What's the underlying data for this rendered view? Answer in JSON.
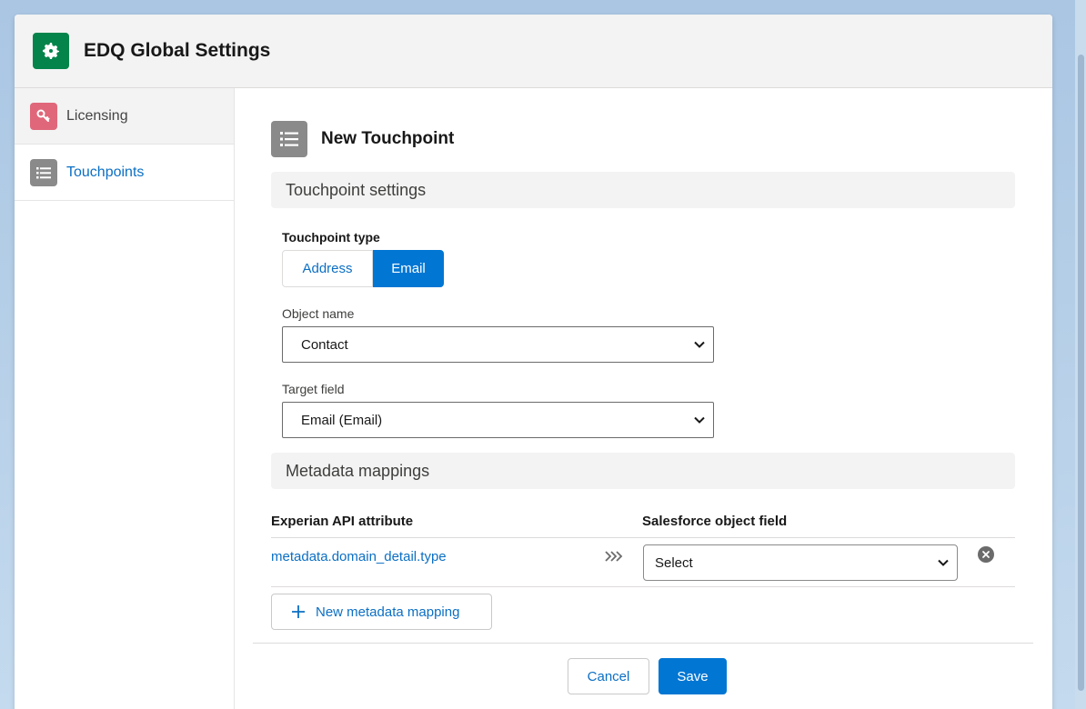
{
  "app": {
    "title": "EDQ Global Settings",
    "header_icon": "gear-icon",
    "accent_color": "#04844b"
  },
  "sidebar": {
    "items": [
      {
        "label": "Licensing",
        "icon": "key-icon",
        "icon_color": "#e0677a",
        "active": false
      },
      {
        "label": "Touchpoints",
        "icon": "list-icon",
        "icon_color": "#8a8a8a",
        "active": true
      }
    ]
  },
  "main": {
    "heading": "New Touchpoint",
    "heading_icon": "list-icon",
    "sections": {
      "settings": "Touchpoint settings",
      "metadata": "Metadata mappings"
    },
    "touchpoint_type": {
      "label": "Touchpoint type",
      "options": [
        "Address",
        "Email"
      ],
      "selected": "Email"
    },
    "object_name": {
      "label": "Object name",
      "value": "Contact"
    },
    "target_field": {
      "label": "Target field",
      "value": "Email (Email)"
    },
    "mapping_table": {
      "headers": [
        "Experian API attribute",
        "Salesforce object field"
      ],
      "rows": [
        {
          "attribute": "metadata.domain_detail.type",
          "field": "Select"
        }
      ]
    },
    "new_mapping_label": "New metadata mapping"
  },
  "footer": {
    "cancel_label": "Cancel",
    "save_label": "Save",
    "primary_color": "#0176d3"
  }
}
